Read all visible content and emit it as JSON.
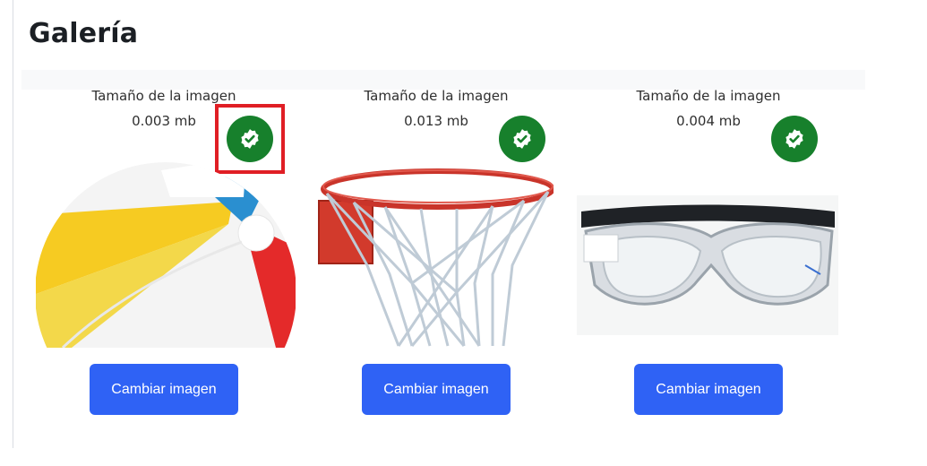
{
  "header": {
    "title": "Galería"
  },
  "gallery": {
    "items": [
      {
        "size_label": "Tamaño de la imagen",
        "size_value": "0.003 mb",
        "button_label": "Cambiar imagen",
        "image_subject": "beach-ball"
      },
      {
        "size_label": "Tamaño de la imagen",
        "size_value": "0.013 mb",
        "button_label": "Cambiar imagen",
        "image_subject": "basketball-hoop"
      },
      {
        "size_label": "Tamaño de la imagen",
        "size_value": "0.004 mb",
        "button_label": "Cambiar imagen",
        "image_subject": "sports-goggles"
      }
    ]
  },
  "icons": {
    "badge": "verified-check-icon"
  },
  "colors": {
    "accent": "#2f62f5",
    "badge": "#17802c",
    "highlight": "#e01e25",
    "title": "#1b1f24"
  }
}
